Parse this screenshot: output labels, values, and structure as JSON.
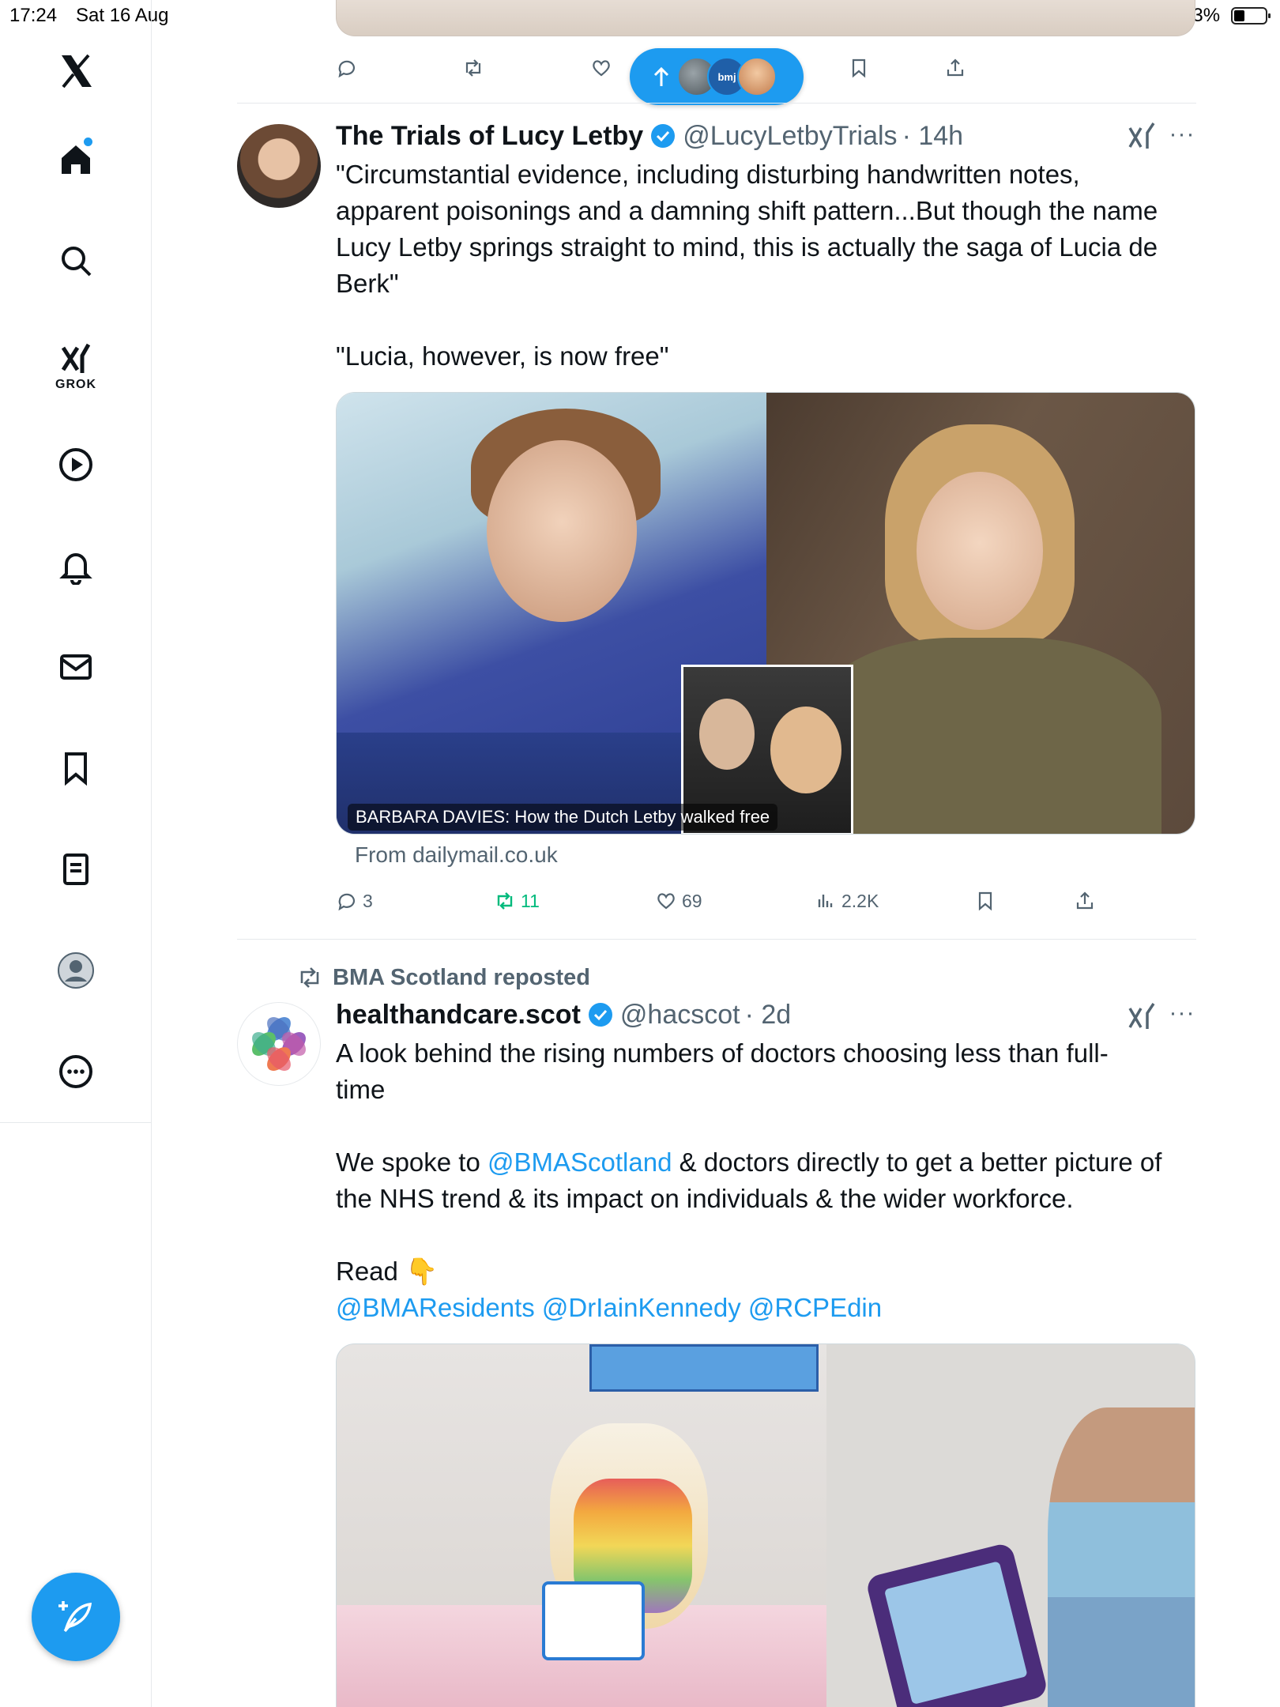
{
  "status_bar": {
    "time": "17:24",
    "date": "Sat 16 Aug",
    "battery_percent": "33%",
    "battery_level": 0.33
  },
  "sidebar": {
    "grok_label": "GROK",
    "accent_color": "#1d9bf0"
  },
  "feed": {
    "new_posts_pill": {
      "avatar_label": "bmj"
    },
    "top_actions": {
      "reply": "",
      "repost": "",
      "like": ""
    },
    "tweets": [
      {
        "author": "The Trials of Lucy Letby",
        "handle": "@LucyLetbyTrials",
        "time": "· 14h",
        "text_lines": [
          "\"Circumstantial evidence, including disturbing handwritten notes,",
          "apparent poisonings and a damning shift pattern...But though the name",
          "Lucy Letby springs straight to mind, this is actually the saga of Lucia de",
          "Berk\""
        ],
        "text_2": "\"Lucia, however, is now free\"",
        "card_caption": "BARBARA DAVIES: How the Dutch Letby walked free",
        "card_source": "From dailymail.co.uk",
        "replies": "3",
        "reposts": "11",
        "likes": "69",
        "views": "2.2K"
      },
      {
        "repost_label": "BMA Scotland reposted",
        "author": "healthandcare.scot",
        "handle": "@hacscot",
        "time": "· 2d",
        "text_line1": "A look behind the rising numbers of doctors choosing less than full-",
        "text_line2": "time",
        "para2_pre": "We spoke to ",
        "para2_mention": "@BMAScotland",
        "para2_post": " & doctors directly to get a better picture of",
        "para2_line2": "the NHS trend & its impact on individuals & the wider workforce.",
        "read": "Read 👇",
        "mentions": "@BMAResidents @DrIainKennedy @RCPEdin"
      }
    ]
  }
}
